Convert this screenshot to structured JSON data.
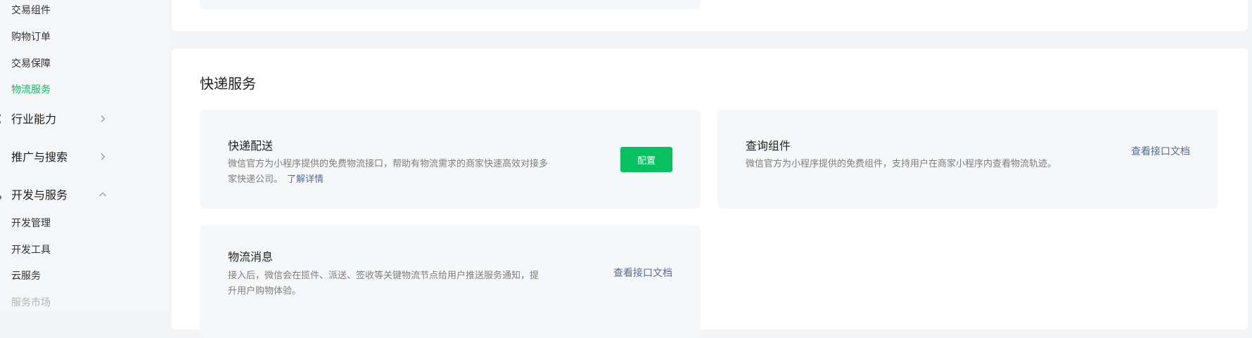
{
  "sidebar": {
    "trade_sub": [
      "交易组件",
      "购物订单",
      "交易保障",
      "物流服务"
    ],
    "active_item": "物流服务",
    "groups": [
      {
        "label": "行业能力",
        "icon": "industry-icon",
        "chevron": "chevron-right-icon"
      },
      {
        "label": "推广与搜索",
        "icon": "promotion-icon",
        "chevron": "chevron-right-icon"
      },
      {
        "label": "开发与服务",
        "icon": "dev-icon",
        "chevron": "chevron-up-icon"
      }
    ],
    "dev_sub": [
      "开发管理",
      "开发工具",
      "云服务",
      "服务市场"
    ]
  },
  "main": {
    "section_title": "快递服务",
    "tiles": {
      "delivery": {
        "title": "快递配送",
        "desc_line1": "微信官方为小程序提供的免费物流接口，帮助有物流需求的商家快速高效对接多",
        "desc_line2": "家快递公司。",
        "link": "了解详情",
        "button": "配置"
      },
      "query": {
        "title": "查询组件",
        "desc": "微信官方为小程序提供的免费组件，支持用户在商家小程序内查看物流轨迹。",
        "link": "查看接口文档"
      },
      "message": {
        "title": "物流消息",
        "desc_line1": "接入后，微信会在揽件、派送、签收等关键物流节点给用户推送服务通知，提",
        "desc_line2": "升用户购物体验。",
        "link": "查看接口文档"
      }
    }
  },
  "colors": {
    "accent": "#07c160",
    "link": "#576b95",
    "page_bg": "#f3f4f6",
    "tile_bg": "#f6f7f8"
  }
}
